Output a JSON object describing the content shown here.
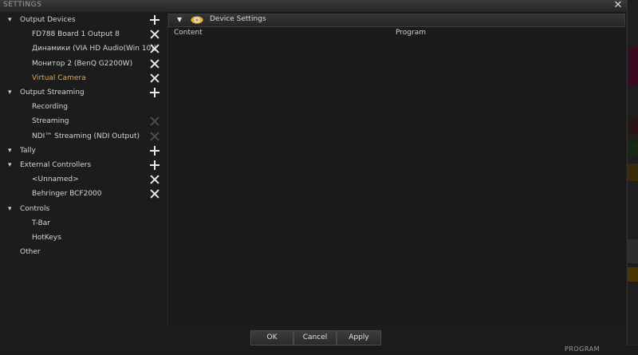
{
  "window": {
    "title": "SETTINGS",
    "close_glyph": "✕"
  },
  "tree": [
    {
      "label": "Output Devices",
      "level": 0,
      "expanded": true,
      "action": "plus"
    },
    {
      "label": "FD788 Board 1 Output 8",
      "level": 1,
      "action": "remove"
    },
    {
      "label": "Динамики (VIA HD Audio(Win 10))",
      "level": 1,
      "action": "remove"
    },
    {
      "label": "Монитор 2 (BenQ G2200W)",
      "level": 1,
      "action": "remove"
    },
    {
      "label": "Virtual Camera",
      "level": 1,
      "action": "remove",
      "selected": true
    },
    {
      "label": "Output Streaming",
      "level": 0,
      "expanded": true,
      "action": "plus"
    },
    {
      "label": "Recording",
      "level": 1,
      "action": "none"
    },
    {
      "label": "Streaming",
      "level": 1,
      "action": "remove-disabled"
    },
    {
      "label": "NDI™ Streaming (NDI Output)",
      "level": 1,
      "action": "remove-disabled"
    },
    {
      "label": "Tally",
      "level": 0,
      "expanded": true,
      "action": "plus"
    },
    {
      "label": "External Controllers",
      "level": 0,
      "expanded": true,
      "action": "plus"
    },
    {
      "label": "<Unnamed>",
      "level": 1,
      "action": "remove"
    },
    {
      "label": "Behringer BCF2000",
      "level": 1,
      "action": "remove"
    },
    {
      "label": "Controls",
      "level": 0,
      "expanded": true,
      "action": "none"
    },
    {
      "label": "T-Bar",
      "level": 1,
      "action": "none"
    },
    {
      "label": "HotKeys",
      "level": 1,
      "action": "none"
    },
    {
      "label": "Other",
      "level": 0,
      "expanded": false,
      "action": "none"
    }
  ],
  "panel": {
    "header_title": "Device Settings",
    "columns": [
      "Content",
      "Program"
    ]
  },
  "buttons": {
    "ok": "OK",
    "cancel": "Cancel",
    "apply": "Apply"
  },
  "background_app": {
    "bottom_text": "PROGRAM"
  },
  "colors": {
    "selected_text": "#f0a622",
    "background": "#1d1d1d",
    "accent_icon": "#f0b030"
  },
  "icons": {
    "expand": "caret-down-icon",
    "add": "plus-icon",
    "remove": "close-icon",
    "device": "camera-icon"
  }
}
